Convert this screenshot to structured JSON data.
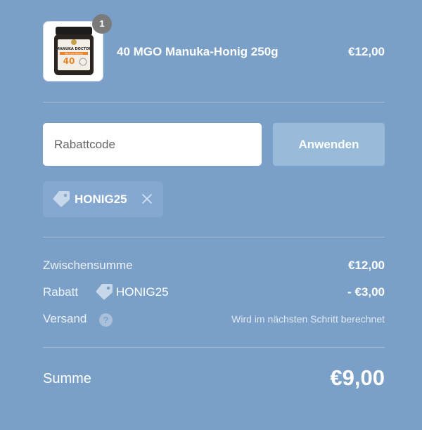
{
  "product": {
    "quantity": "1",
    "name": "40 MGO Manuka-Honig 250g",
    "price": "€12,00",
    "image": {
      "brand": "MANUKA DOCTOR",
      "sublabel": "Manuka Honey",
      "grade": "40"
    }
  },
  "discount": {
    "placeholder": "Rabattcode",
    "apply_label": "Anwenden",
    "applied_code": "HONIG25"
  },
  "summary": {
    "subtotal_label": "Zwischensumme",
    "subtotal_value": "€12,00",
    "discount_label": "Rabatt",
    "discount_code": "HONIG25",
    "discount_value": "- €3,00",
    "shipping_label": "Versand",
    "shipping_help": "?",
    "shipping_value": "Wird im nächsten Schritt berechnet",
    "total_label": "Summe",
    "total_value": "€9,00"
  },
  "colors": {
    "background": "#7ba0c8",
    "button": "#98bbd9",
    "chip": "#84a8d0"
  }
}
